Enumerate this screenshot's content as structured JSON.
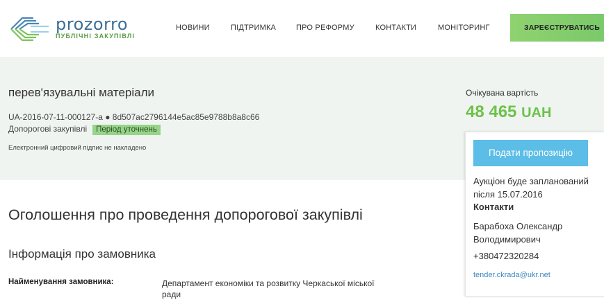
{
  "brand": {
    "name": "prozorro",
    "tagline": "ПУБЛІЧНІ ЗАКУПІВЛІ"
  },
  "nav": [
    {
      "label": "НОВИНИ"
    },
    {
      "label": "ПІДТРИМКА"
    },
    {
      "label": "ПРО РЕФОРМУ"
    },
    {
      "label": "КОНТАКТИ"
    },
    {
      "label": "МОНІТОРИНГ"
    }
  ],
  "register_label": "ЗАРЕЄСТРУВАТИСЬ",
  "tender": {
    "title": "перев'язувальні матеріали",
    "id": "UA-2016-07-11-000127-a ● 8d507ac2796144e5ac85e9788b8a8c66",
    "procurement_type": "Допорогові закупівлі",
    "status": "Період уточнень",
    "signature_note": "Електронний цифровий підпис не накладено"
  },
  "expected": {
    "label": "Очікувана вартість",
    "amount": "48 465",
    "currency": "UAH"
  },
  "card": {
    "offer_button": "Подати пропозицію",
    "auction_note": "Аукціон буде запланований після 15.07.2016",
    "contacts_heading": "Контакти",
    "contact_name": "Барабоха Олександр Володимирович",
    "phone": "+380472320284",
    "email": "tender.ckrada@ukr.net"
  },
  "main": {
    "heading": "Оголошення про проведення допорогової закупівлі",
    "section": "Інформація про замовника",
    "fields": [
      {
        "label": "Найменування замовника:",
        "value": "Департамент економіки та розвитку Черкаської міської ради"
      }
    ]
  },
  "colors": {
    "accent_green": "#6cc24a",
    "button_blue": "#5cbde7",
    "band_bg": "#f0f4f0",
    "brand_blue": "#3a6f98"
  }
}
